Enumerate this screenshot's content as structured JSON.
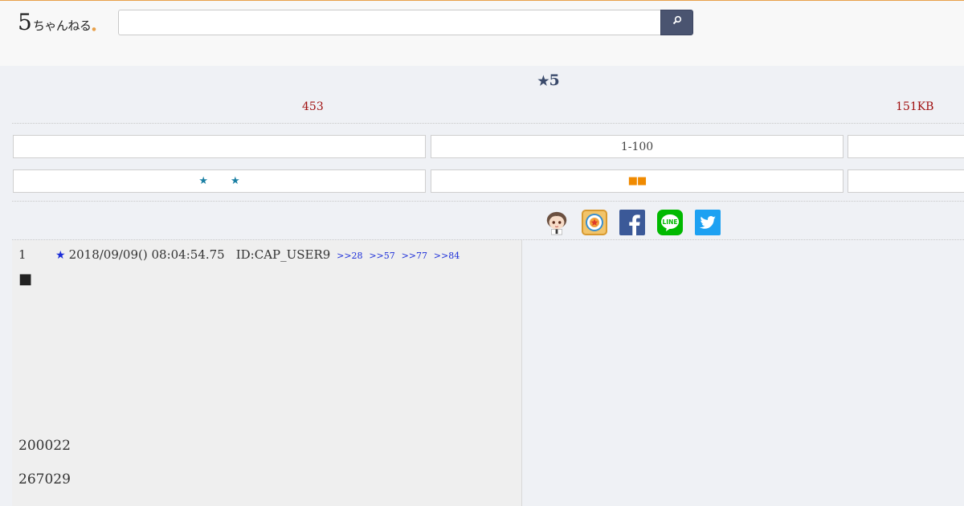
{
  "header": {
    "logo_digit": "5",
    "logo_kana": "ちゃんねる",
    "search": {
      "value": "",
      "placeholder": ""
    }
  },
  "thread": {
    "title_star": "★",
    "title_number": "5",
    "response_count": "453",
    "size": "151KB"
  },
  "nav": {
    "range_label": "1-100",
    "star_a": "★",
    "star_b": "★",
    "squares": "■■"
  },
  "share": {
    "icons": [
      "mascot-icon",
      "app-icon",
      "facebook-icon",
      "line-icon",
      "twitter-icon"
    ],
    "line_text": "LINE",
    "colors": {
      "facebook": "#3b5998",
      "line": "#00b900",
      "twitter": "#1da1f2"
    }
  },
  "post": {
    "number": "1",
    "star": "★",
    "datetime": "2018/09/09() 08:04:54.75",
    "id": "ID:CAP_USER9",
    "replies": [
      ">>28",
      ">>57",
      ">>77",
      ">>84"
    ],
    "bullet": "■",
    "lines": [
      "200022",
      "267029"
    ]
  },
  "colors": {
    "accent": "#e8a04a",
    "link": "#1a2cd8",
    "count": "#a01010",
    "search_button": "#4a5470",
    "title": "#3a4a6b"
  }
}
